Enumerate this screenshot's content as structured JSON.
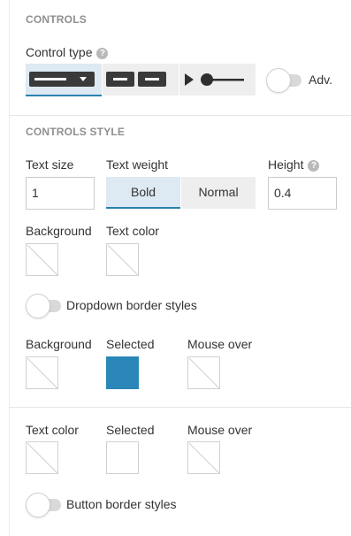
{
  "controls": {
    "section_title": "CONTROLS",
    "control_type_label": "Control type",
    "control_type_options": [
      "dropdown-icon",
      "buttons-icon",
      "slider-icon"
    ],
    "selected_option": 0,
    "adv_label": "Adv."
  },
  "controls_style": {
    "section_title": "CONTROLS STYLE",
    "text_size_label": "Text size",
    "text_size_value": "1",
    "text_weight_label": "Text weight",
    "text_weight_options": [
      "Bold",
      "Normal"
    ],
    "text_weight_selected": "Bold",
    "height_label": "Height",
    "height_value": "0.4",
    "background_label": "Background",
    "text_color_label": "Text color",
    "dropdown_border_toggle_label": "Dropdown border styles",
    "dropdown_states": {
      "background_label": "Background",
      "selected_label": "Selected",
      "mouse_over_label": "Mouse over",
      "selected_color": "#2b87b8"
    },
    "button_states": {
      "text_color_label": "Text color",
      "selected_label": "Selected",
      "mouse_over_label": "Mouse over"
    },
    "button_border_toggle_label": "Button border styles"
  },
  "colors": {
    "accent": "#2a81ad",
    "selected_segment_bg": "#dde9f3",
    "segment_bg": "#eeeeee",
    "section_title": "#8f8f8f"
  }
}
